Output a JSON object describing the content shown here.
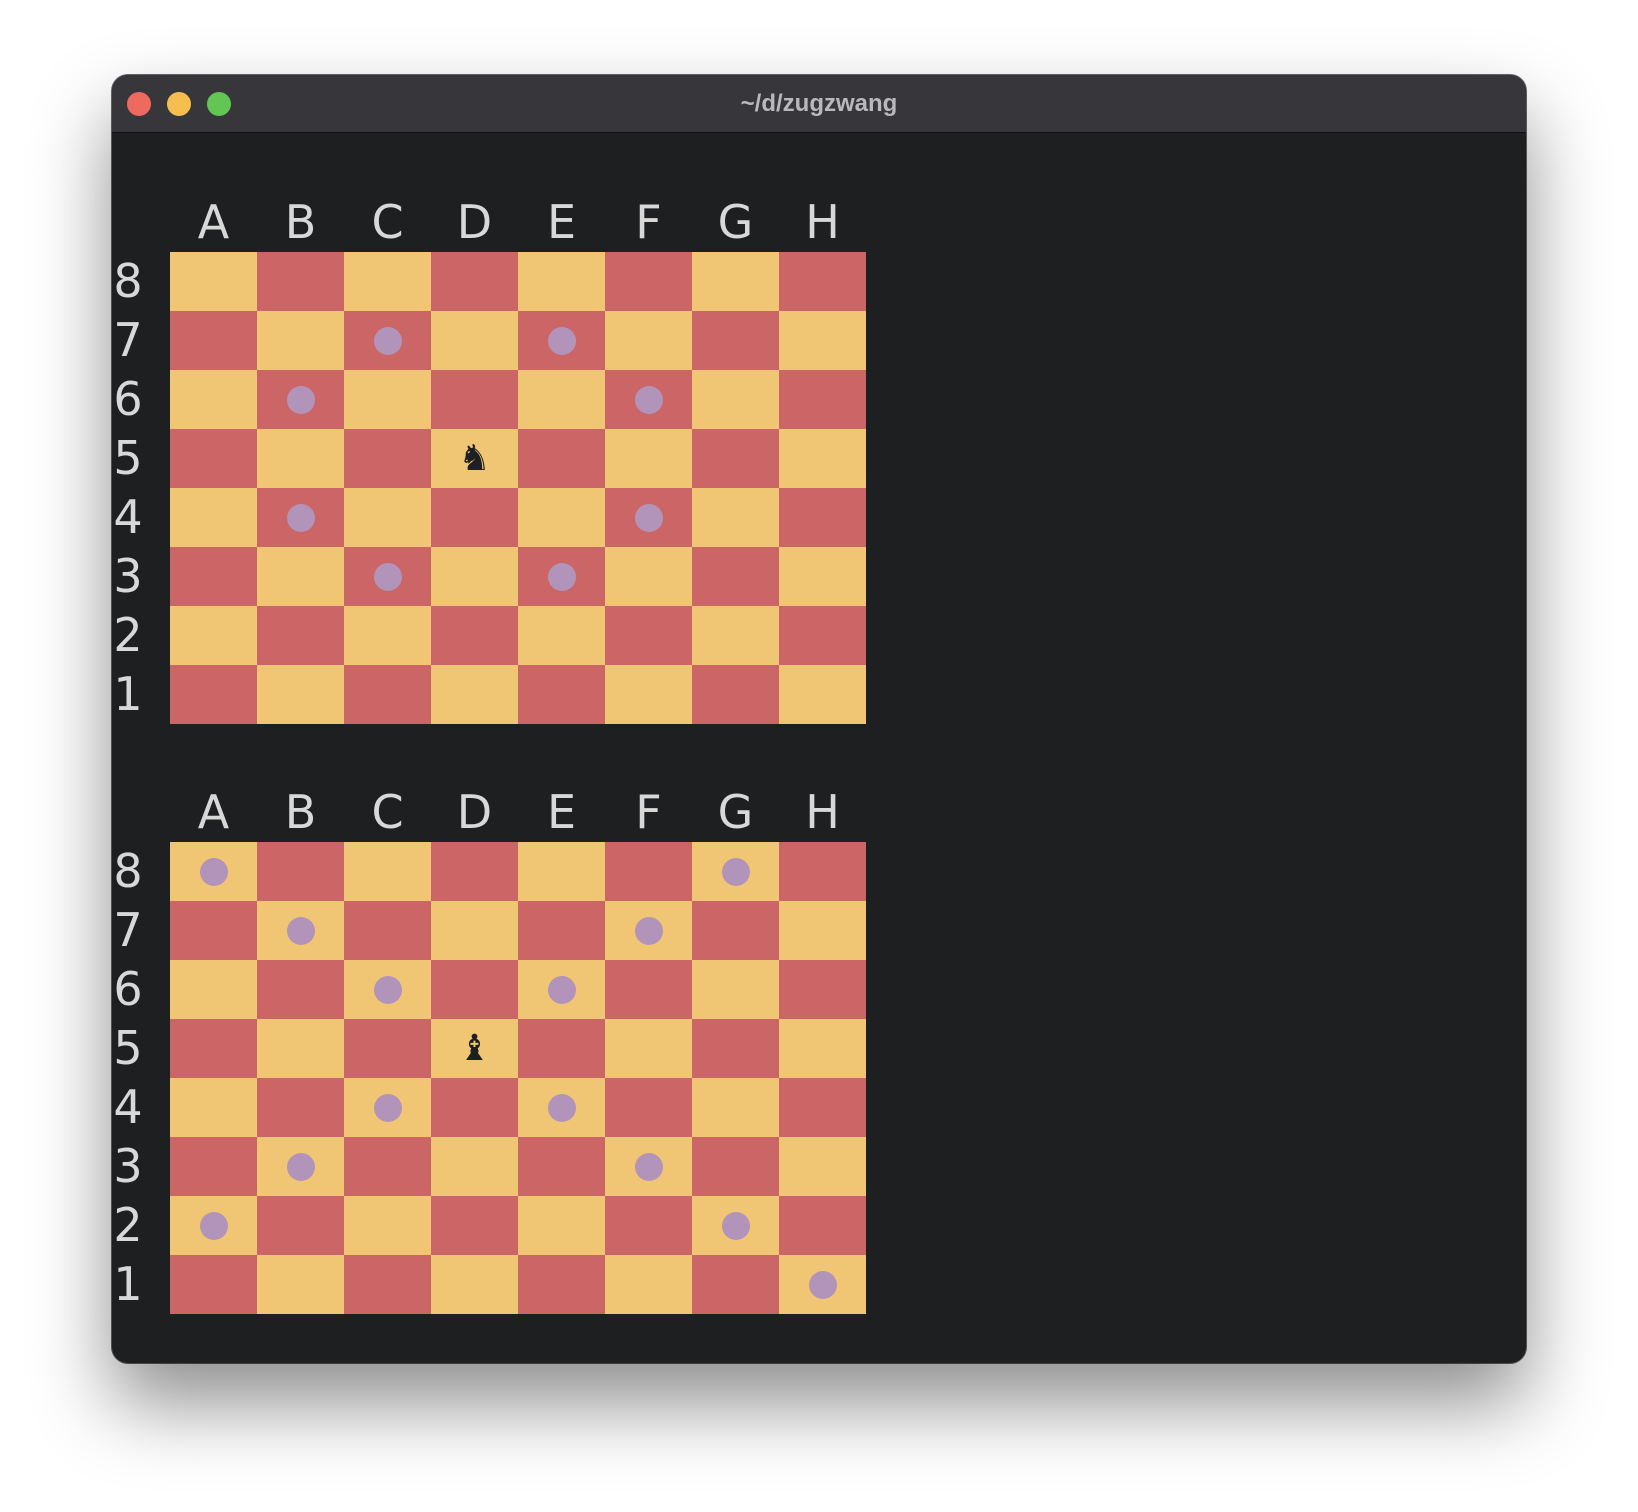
{
  "window": {
    "title": "~/d/zugzwang",
    "traffic_lights": [
      {
        "name": "close",
        "color": "#ee6a5f"
      },
      {
        "name": "minimize",
        "color": "#f5be4f"
      },
      {
        "name": "zoom",
        "color": "#62c554"
      }
    ]
  },
  "colors": {
    "light_square": "#f0c674",
    "dark_square": "#cc6666",
    "move_marker": "#b294bb",
    "piece": "#1d1f21",
    "label": "#d8d8d8",
    "background": "#1e1f21"
  },
  "boards": [
    {
      "files": [
        "A",
        "B",
        "C",
        "D",
        "E",
        "F",
        "G",
        "H"
      ],
      "ranks": [
        "8",
        "7",
        "6",
        "5",
        "4",
        "3",
        "2",
        "1"
      ],
      "piece": {
        "square": "D5",
        "type": "knight",
        "glyph": "♞"
      },
      "markers": [
        "C7",
        "E7",
        "B6",
        "F6",
        "B4",
        "F4",
        "C3",
        "E3"
      ]
    },
    {
      "files": [
        "A",
        "B",
        "C",
        "D",
        "E",
        "F",
        "G",
        "H"
      ],
      "ranks": [
        "8",
        "7",
        "6",
        "5",
        "4",
        "3",
        "2",
        "1"
      ],
      "piece": {
        "square": "D5",
        "type": "bishop",
        "glyph": "♝"
      },
      "markers": [
        "A8",
        "G8",
        "B7",
        "F7",
        "C6",
        "E6",
        "C4",
        "E4",
        "B3",
        "F3",
        "A2",
        "G2",
        "H1"
      ]
    }
  ]
}
